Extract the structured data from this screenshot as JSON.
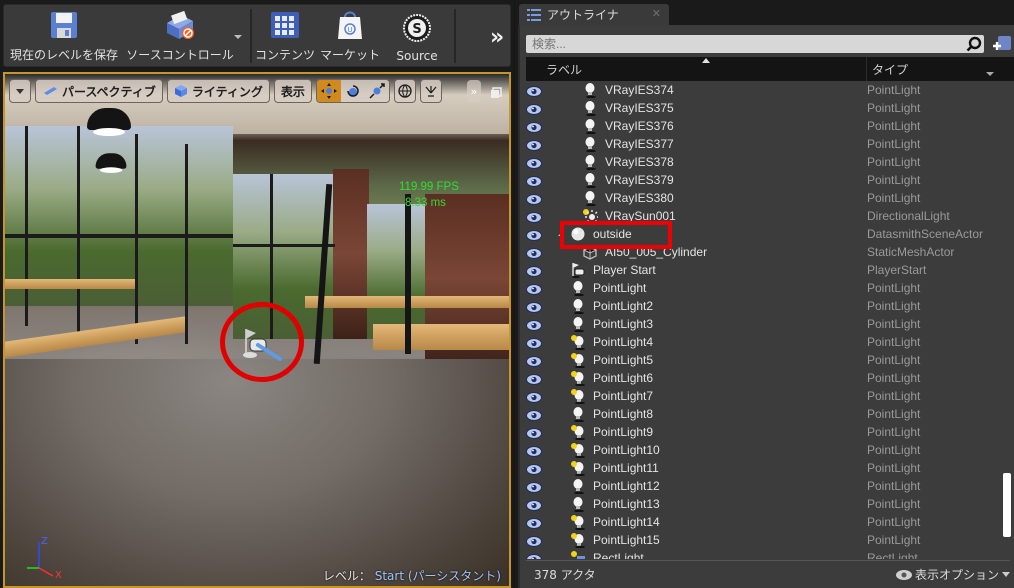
{
  "toolbar": {
    "save_level": "現在のレベルを保存",
    "source_control": "ソースコントロール",
    "content": "コンテンツ",
    "marketplace": "マーケット",
    "source": "Source",
    "more": "»"
  },
  "viewport": {
    "perspective": "パースペクティブ",
    "lighting": "ライティング",
    "show": "表示",
    "fps": "119.99 FPS",
    "ms": "8.33 ms",
    "axis": {
      "z": "Z",
      "x": "X"
    },
    "level_prefix": "レベル：",
    "level_name": "Start (パーシスタント)"
  },
  "outliner": {
    "tab_title": "アウトライナ",
    "search_placeholder": "検索...",
    "col_label": "ラベル",
    "col_type": "タイプ",
    "actor_count": "378 アクタ",
    "view_options": "表示オプション",
    "rows": [
      {
        "label": "VRayIES374",
        "type": "PointLight",
        "icon": "pointlight",
        "indent": 2
      },
      {
        "label": "VRayIES375",
        "type": "PointLight",
        "icon": "pointlight",
        "indent": 2
      },
      {
        "label": "VRayIES376",
        "type": "PointLight",
        "icon": "pointlight",
        "indent": 2
      },
      {
        "label": "VRayIES377",
        "type": "PointLight",
        "icon": "pointlight",
        "indent": 2
      },
      {
        "label": "VRayIES378",
        "type": "PointLight",
        "icon": "pointlight",
        "indent": 2
      },
      {
        "label": "VRayIES379",
        "type": "PointLight",
        "icon": "pointlight",
        "indent": 2
      },
      {
        "label": "VRayIES380",
        "type": "PointLight",
        "icon": "pointlight",
        "indent": 2
      },
      {
        "label": "VRaySun001",
        "type": "DirectionalLight",
        "icon": "sun",
        "indent": 2
      },
      {
        "label": "outside",
        "type": "DatasmithSceneActor",
        "icon": "sphere",
        "indent": 1,
        "expanded": true
      },
      {
        "label": "AI50_005_Cylinder",
        "type": "StaticMeshActor",
        "icon": "mesh",
        "indent": 2
      },
      {
        "label": "Player Start",
        "type": "PlayerStart",
        "icon": "playerstart",
        "indent": 1,
        "highlighted": true
      },
      {
        "label": "PointLight",
        "type": "PointLight",
        "icon": "pointlight",
        "indent": 1
      },
      {
        "label": "PointLight2",
        "type": "PointLight",
        "icon": "pointlight",
        "indent": 1
      },
      {
        "label": "PointLight3",
        "type": "PointLight",
        "icon": "pointlight",
        "indent": 1
      },
      {
        "label": "PointLight4",
        "type": "PointLight",
        "icon": "pointlight-mobile",
        "indent": 1
      },
      {
        "label": "PointLight5",
        "type": "PointLight",
        "icon": "pointlight-mobile",
        "indent": 1
      },
      {
        "label": "PointLight6",
        "type": "PointLight",
        "icon": "pointlight-mobile",
        "indent": 1
      },
      {
        "label": "PointLight7",
        "type": "PointLight",
        "icon": "pointlight-mobile",
        "indent": 1
      },
      {
        "label": "PointLight8",
        "type": "PointLight",
        "icon": "pointlight",
        "indent": 1
      },
      {
        "label": "PointLight9",
        "type": "PointLight",
        "icon": "pointlight-mobile",
        "indent": 1
      },
      {
        "label": "PointLight10",
        "type": "PointLight",
        "icon": "pointlight-mobile",
        "indent": 1
      },
      {
        "label": "PointLight11",
        "type": "PointLight",
        "icon": "pointlight-mobile",
        "indent": 1
      },
      {
        "label": "PointLight12",
        "type": "PointLight",
        "icon": "pointlight",
        "indent": 1
      },
      {
        "label": "PointLight13",
        "type": "PointLight",
        "icon": "pointlight",
        "indent": 1
      },
      {
        "label": "PointLight14",
        "type": "PointLight",
        "icon": "pointlight-mobile",
        "indent": 1
      },
      {
        "label": "PointLight15",
        "type": "PointLight",
        "icon": "pointlight-mobile",
        "indent": 1
      },
      {
        "label": "RectLight",
        "type": "RectLight",
        "icon": "rectlight",
        "indent": 1
      }
    ]
  },
  "colors": {
    "highlight": "#ee0000",
    "fps_text": "#33dd33",
    "viewport_border": "#c8952a",
    "active_tool": "#d08a1e"
  }
}
